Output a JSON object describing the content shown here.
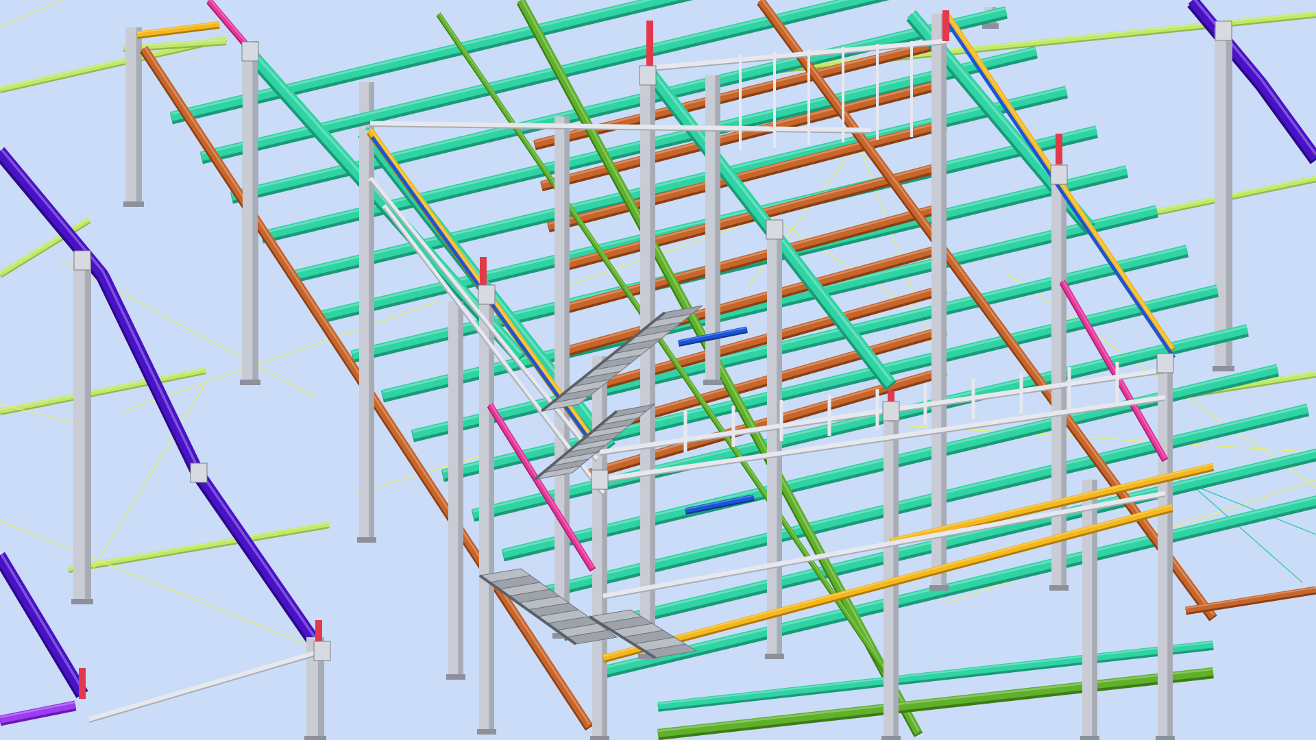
{
  "scene": {
    "background": "#cbdcf8",
    "colors": {
      "rafter_purple": "#4a12c8",
      "rafter_purple_dark": "#2c0a86",
      "column_grey": "#c9ccd4",
      "column_grey_dark": "#8d919b",
      "beam_teal": "#2fd3a4",
      "beam_teal_dark": "#1a9a78",
      "beam_orange": "#c8652a",
      "beam_orange_dark": "#8a3f15",
      "beam_green": "#5fb12a",
      "purlin_lime": "#c2e86a",
      "edge_yellow": "#f5b81c",
      "edge_blue": "#1b55d6",
      "edge_magenta": "#e8359c",
      "post_red": "#e23a4a",
      "railing_light": "#e6e8ee",
      "bracing_yellow": "#e9ef6a",
      "bracing_cyan": "#39c6b7",
      "stair_grey": "#9ea2aa"
    },
    "elements": [
      "steel-rafter",
      "steel-column",
      "floor-beam",
      "edge-beam",
      "purlin",
      "cross-bracing",
      "guard-railing",
      "stair-flight",
      "post-stub"
    ]
  }
}
